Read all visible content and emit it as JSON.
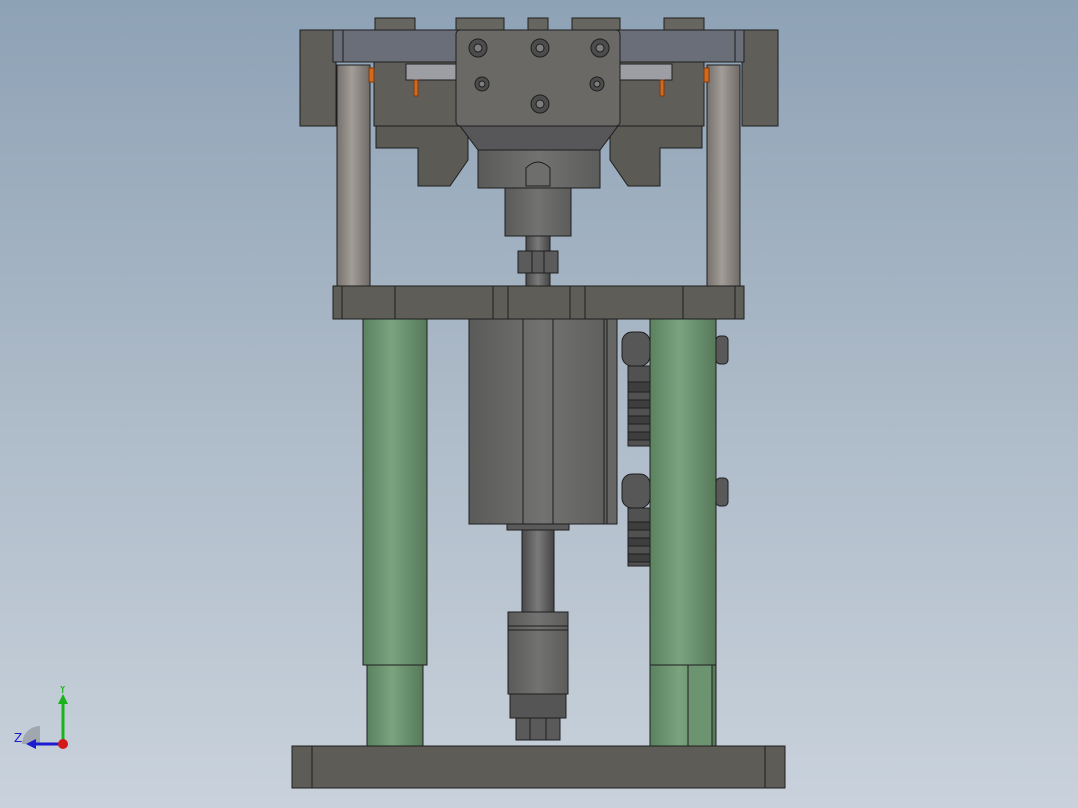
{
  "viewport": {
    "background_top": "#8ea2b6",
    "background_bottom": "#c9d2dc"
  },
  "model": {
    "description_icon": "pneumatic-press-assembly",
    "colors": {
      "frame_dark": "#5e5d58",
      "frame_mid": "#6c6b66",
      "guide_post": "#8e8a86",
      "green_column": "#6e9672",
      "cylinder": "#6a6a68",
      "fitting": "#565656",
      "accent_orange": "#d2691e",
      "outline": "#1e1e1e"
    }
  },
  "triad": {
    "y_label": "Y",
    "z_label": "Z",
    "y_color": "#19b419",
    "z_color": "#1b1bd0",
    "x_color": "#d11a1a"
  }
}
